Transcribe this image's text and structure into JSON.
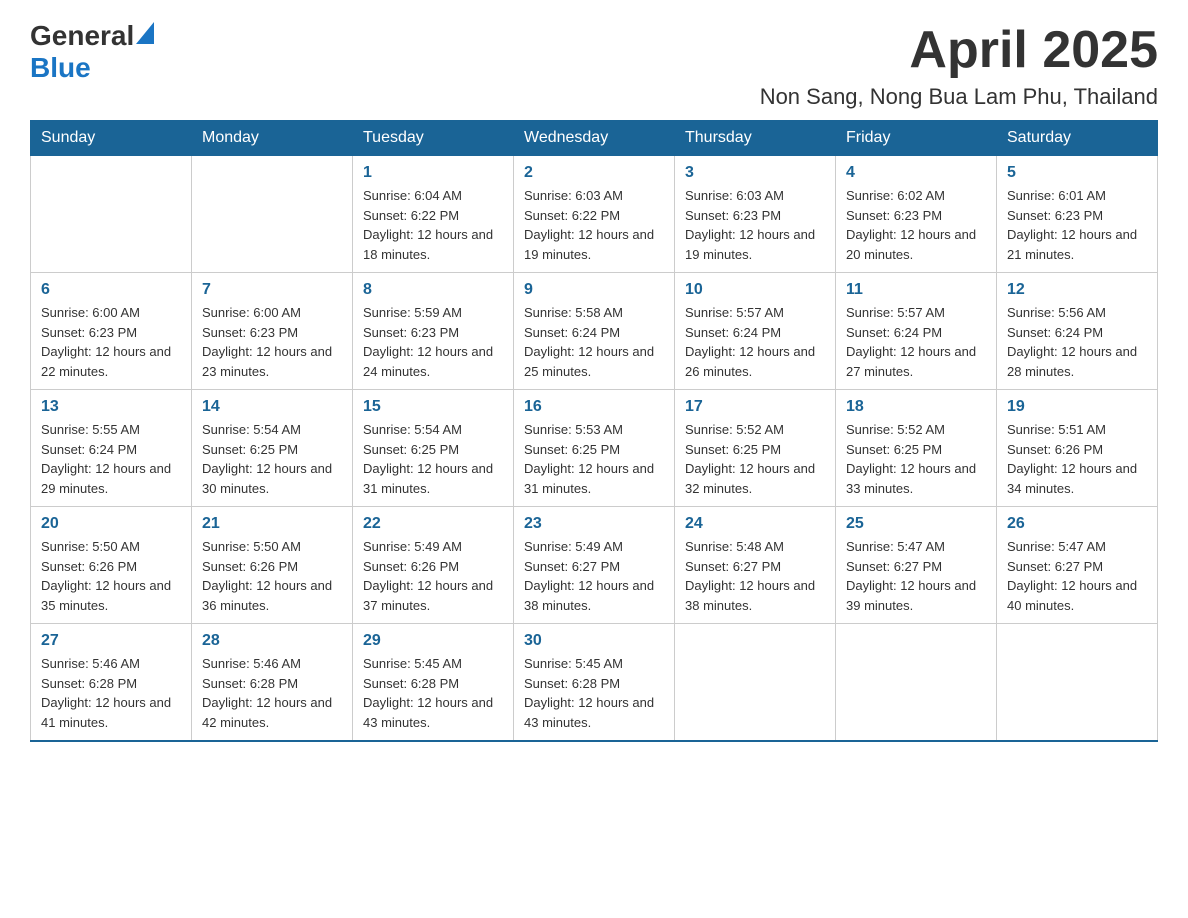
{
  "logo": {
    "general": "General",
    "blue": "Blue"
  },
  "title": {
    "month_year": "April 2025",
    "location": "Non Sang, Nong Bua Lam Phu, Thailand"
  },
  "days_of_week": [
    "Sunday",
    "Monday",
    "Tuesday",
    "Wednesday",
    "Thursday",
    "Friday",
    "Saturday"
  ],
  "weeks": [
    [
      {
        "day": "",
        "sunrise": "",
        "sunset": "",
        "daylight": ""
      },
      {
        "day": "",
        "sunrise": "",
        "sunset": "",
        "daylight": ""
      },
      {
        "day": "1",
        "sunrise": "Sunrise: 6:04 AM",
        "sunset": "Sunset: 6:22 PM",
        "daylight": "Daylight: 12 hours and 18 minutes."
      },
      {
        "day": "2",
        "sunrise": "Sunrise: 6:03 AM",
        "sunset": "Sunset: 6:22 PM",
        "daylight": "Daylight: 12 hours and 19 minutes."
      },
      {
        "day": "3",
        "sunrise": "Sunrise: 6:03 AM",
        "sunset": "Sunset: 6:23 PM",
        "daylight": "Daylight: 12 hours and 19 minutes."
      },
      {
        "day": "4",
        "sunrise": "Sunrise: 6:02 AM",
        "sunset": "Sunset: 6:23 PM",
        "daylight": "Daylight: 12 hours and 20 minutes."
      },
      {
        "day": "5",
        "sunrise": "Sunrise: 6:01 AM",
        "sunset": "Sunset: 6:23 PM",
        "daylight": "Daylight: 12 hours and 21 minutes."
      }
    ],
    [
      {
        "day": "6",
        "sunrise": "Sunrise: 6:00 AM",
        "sunset": "Sunset: 6:23 PM",
        "daylight": "Daylight: 12 hours and 22 minutes."
      },
      {
        "day": "7",
        "sunrise": "Sunrise: 6:00 AM",
        "sunset": "Sunset: 6:23 PM",
        "daylight": "Daylight: 12 hours and 23 minutes."
      },
      {
        "day": "8",
        "sunrise": "Sunrise: 5:59 AM",
        "sunset": "Sunset: 6:23 PM",
        "daylight": "Daylight: 12 hours and 24 minutes."
      },
      {
        "day": "9",
        "sunrise": "Sunrise: 5:58 AM",
        "sunset": "Sunset: 6:24 PM",
        "daylight": "Daylight: 12 hours and 25 minutes."
      },
      {
        "day": "10",
        "sunrise": "Sunrise: 5:57 AM",
        "sunset": "Sunset: 6:24 PM",
        "daylight": "Daylight: 12 hours and 26 minutes."
      },
      {
        "day": "11",
        "sunrise": "Sunrise: 5:57 AM",
        "sunset": "Sunset: 6:24 PM",
        "daylight": "Daylight: 12 hours and 27 minutes."
      },
      {
        "day": "12",
        "sunrise": "Sunrise: 5:56 AM",
        "sunset": "Sunset: 6:24 PM",
        "daylight": "Daylight: 12 hours and 28 minutes."
      }
    ],
    [
      {
        "day": "13",
        "sunrise": "Sunrise: 5:55 AM",
        "sunset": "Sunset: 6:24 PM",
        "daylight": "Daylight: 12 hours and 29 minutes."
      },
      {
        "day": "14",
        "sunrise": "Sunrise: 5:54 AM",
        "sunset": "Sunset: 6:25 PM",
        "daylight": "Daylight: 12 hours and 30 minutes."
      },
      {
        "day": "15",
        "sunrise": "Sunrise: 5:54 AM",
        "sunset": "Sunset: 6:25 PM",
        "daylight": "Daylight: 12 hours and 31 minutes."
      },
      {
        "day": "16",
        "sunrise": "Sunrise: 5:53 AM",
        "sunset": "Sunset: 6:25 PM",
        "daylight": "Daylight: 12 hours and 31 minutes."
      },
      {
        "day": "17",
        "sunrise": "Sunrise: 5:52 AM",
        "sunset": "Sunset: 6:25 PM",
        "daylight": "Daylight: 12 hours and 32 minutes."
      },
      {
        "day": "18",
        "sunrise": "Sunrise: 5:52 AM",
        "sunset": "Sunset: 6:25 PM",
        "daylight": "Daylight: 12 hours and 33 minutes."
      },
      {
        "day": "19",
        "sunrise": "Sunrise: 5:51 AM",
        "sunset": "Sunset: 6:26 PM",
        "daylight": "Daylight: 12 hours and 34 minutes."
      }
    ],
    [
      {
        "day": "20",
        "sunrise": "Sunrise: 5:50 AM",
        "sunset": "Sunset: 6:26 PM",
        "daylight": "Daylight: 12 hours and 35 minutes."
      },
      {
        "day": "21",
        "sunrise": "Sunrise: 5:50 AM",
        "sunset": "Sunset: 6:26 PM",
        "daylight": "Daylight: 12 hours and 36 minutes."
      },
      {
        "day": "22",
        "sunrise": "Sunrise: 5:49 AM",
        "sunset": "Sunset: 6:26 PM",
        "daylight": "Daylight: 12 hours and 37 minutes."
      },
      {
        "day": "23",
        "sunrise": "Sunrise: 5:49 AM",
        "sunset": "Sunset: 6:27 PM",
        "daylight": "Daylight: 12 hours and 38 minutes."
      },
      {
        "day": "24",
        "sunrise": "Sunrise: 5:48 AM",
        "sunset": "Sunset: 6:27 PM",
        "daylight": "Daylight: 12 hours and 38 minutes."
      },
      {
        "day": "25",
        "sunrise": "Sunrise: 5:47 AM",
        "sunset": "Sunset: 6:27 PM",
        "daylight": "Daylight: 12 hours and 39 minutes."
      },
      {
        "day": "26",
        "sunrise": "Sunrise: 5:47 AM",
        "sunset": "Sunset: 6:27 PM",
        "daylight": "Daylight: 12 hours and 40 minutes."
      }
    ],
    [
      {
        "day": "27",
        "sunrise": "Sunrise: 5:46 AM",
        "sunset": "Sunset: 6:28 PM",
        "daylight": "Daylight: 12 hours and 41 minutes."
      },
      {
        "day": "28",
        "sunrise": "Sunrise: 5:46 AM",
        "sunset": "Sunset: 6:28 PM",
        "daylight": "Daylight: 12 hours and 42 minutes."
      },
      {
        "day": "29",
        "sunrise": "Sunrise: 5:45 AM",
        "sunset": "Sunset: 6:28 PM",
        "daylight": "Daylight: 12 hours and 43 minutes."
      },
      {
        "day": "30",
        "sunrise": "Sunrise: 5:45 AM",
        "sunset": "Sunset: 6:28 PM",
        "daylight": "Daylight: 12 hours and 43 minutes."
      },
      {
        "day": "",
        "sunrise": "",
        "sunset": "",
        "daylight": ""
      },
      {
        "day": "",
        "sunrise": "",
        "sunset": "",
        "daylight": ""
      },
      {
        "day": "",
        "sunrise": "",
        "sunset": "",
        "daylight": ""
      }
    ]
  ]
}
